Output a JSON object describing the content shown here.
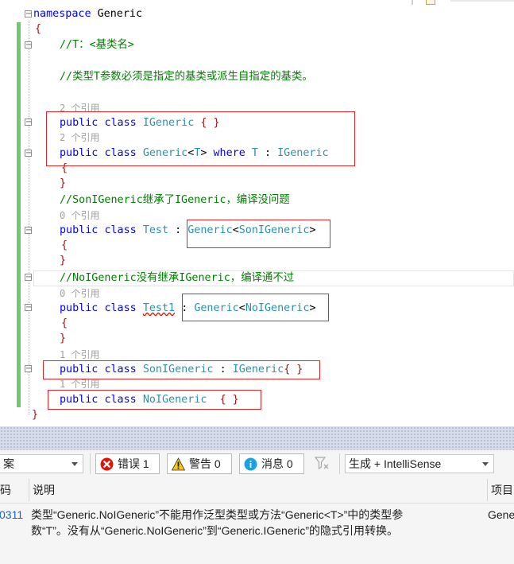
{
  "code": {
    "namespace_kw": "namespace",
    "namespace_name": "Generic",
    "open_brace": "{",
    "close_brace": "}",
    "comment_t": "//T：<基类名>",
    "comment_t_param": "//类型T参数必须是指定的基类或派生自指定的基类。",
    "lens_igeneric": "2 个引用",
    "lens_generic": "2 个引用",
    "lens_test": "0 个引用",
    "lens_test1": "0 个引用",
    "lens_songeneric": "1 个引用",
    "lens_nogeneric": "1 个引用",
    "kw_public": "public",
    "kw_class": "class",
    "kw_where": "where",
    "name_igeneric": "IGeneric",
    "name_generic": "Generic",
    "tparam": "T",
    "lt": "<",
    "gt": ">",
    "colon": ":",
    "empty_body": "{ }",
    "comment_son": "//SonIGeneric继承了IGeneric，编译没问题",
    "name_test": "Test",
    "name_songeneric": "SonIGeneric",
    "comment_no": "//NoIGeneric没有继承IGeneric，编译通不过",
    "name_test1": "Test1",
    "name_nogeneric": "NoIGeneric"
  },
  "toolbar": {
    "scope_value": "案",
    "errors_label": "错误 1",
    "warnings_label": "警告 0",
    "messages_label": "消息 0",
    "build_filter_value": "生成 + IntelliSense"
  },
  "columns": {
    "code": "码",
    "description": "说明",
    "project": "项目"
  },
  "error_row": {
    "code": "0311",
    "description_line1": "类型“Generic.NoIGeneric”不能用作泛型类型或方法“Generic<T>”中的类型参",
    "description_line2": "数“T”。没有从“Generic.NoIGeneric”到“Generic.IGeneric”的隐式引用转换。",
    "project": "Gene"
  },
  "colors": {
    "keyword": "#0000ff",
    "type": "#2b91af",
    "comment": "#008000",
    "brace": "#a31515",
    "highlight_box": "#e02828",
    "change_bar": "#6ccc6c"
  },
  "icons": [
    "error-icon",
    "warning-icon",
    "info-icon",
    "filter-icon",
    "chevron-down-icon",
    "collapse-icon"
  ]
}
